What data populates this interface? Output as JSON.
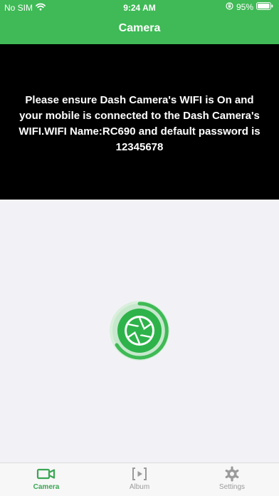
{
  "status_bar": {
    "carrier": "No SIM",
    "time": "9:24 AM",
    "battery": "95%"
  },
  "nav": {
    "title": "Camera"
  },
  "notice": {
    "text": "Please ensure Dash Camera's WIFI is On and your mobile is connected to the Dash Camera's WIFI.WIFI Name:RC690 and default password is 12345678"
  },
  "tabs": [
    {
      "label": "Camera",
      "icon": "video-camera-icon",
      "active": true
    },
    {
      "label": "Album",
      "icon": "album-icon",
      "active": false
    },
    {
      "label": "Settings",
      "icon": "gear-icon",
      "active": false
    }
  ],
  "colors": {
    "accent": "#3fba56",
    "active_tab": "#3aa653",
    "inactive_tab": "#9b9b9b",
    "video_bg": "#000000",
    "page_bg": "#f2f2f6"
  }
}
